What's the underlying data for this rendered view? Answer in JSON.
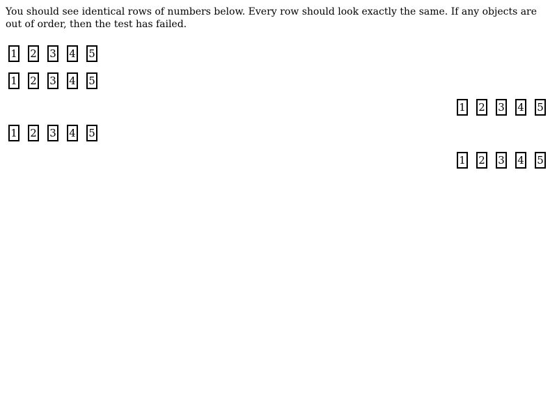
{
  "instructions": "You should see identical rows of numbers below. Every row should look exactly the same. If any objects are out of order, then the test has failed.",
  "rows": [
    {
      "align": "left",
      "items": [
        "1",
        "2",
        "3",
        "4",
        "5"
      ]
    },
    {
      "align": "left",
      "items": [
        "1",
        "2",
        "3",
        "4",
        "5"
      ]
    },
    {
      "align": "right",
      "items": [
        "1",
        "2",
        "3",
        "4",
        "5"
      ]
    },
    {
      "align": "left",
      "items": [
        "1",
        "2",
        "3",
        "4",
        "5"
      ]
    },
    {
      "align": "right",
      "items": [
        "1",
        "2",
        "3",
        "4",
        "5"
      ]
    }
  ]
}
